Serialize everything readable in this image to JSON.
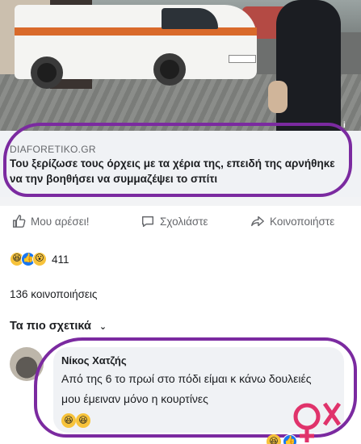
{
  "post": {
    "source": "DIAFORETIKO.GR",
    "headline": "Του ξερίζωσε τους όρχεις με τα χέρια της, επειδή της αρνήθηκε να την βοηθήσει να συμμαζέψει το σπίτι",
    "info_icon": "i"
  },
  "actions": {
    "like": "Μου αρέσει!",
    "comment": "Σχολιάστε",
    "share": "Κοινοποιήστε"
  },
  "reactions": {
    "icons": [
      "haha-icon",
      "like-icon",
      "wow-icon"
    ],
    "count": "411"
  },
  "shares_text": "136 κοινοποιήσεις",
  "related_label": "Τα πιο σχετικά",
  "comment": {
    "author": "Νίκος Χατζής",
    "text": "Από της 6 το πρωί στο πόδι είμαι κ κάνω δουλειές μου έμειναν μόνο η κουρτίνες",
    "reactions": [
      "haha-icon",
      "haha-icon"
    ]
  },
  "colors": {
    "highlight": "#7b2aa0",
    "like_blue": "#1877f2",
    "emoji_yellow": "#f7c33b"
  }
}
